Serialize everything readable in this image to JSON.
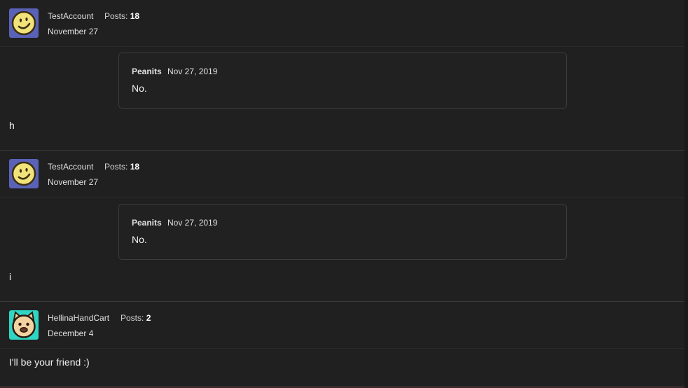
{
  "posts": [
    {
      "author": "TestAccount",
      "posts_label": "Posts:",
      "posts_count": "18",
      "date": "November 27",
      "avatar": "smiley-icon",
      "quote": {
        "author": "Peanits",
        "date": "Nov 27, 2019",
        "text": "No."
      },
      "body": "h"
    },
    {
      "author": "TestAccount",
      "posts_label": "Posts:",
      "posts_count": "18",
      "date": "November 27",
      "avatar": "smiley-icon",
      "quote": {
        "author": "Peanits",
        "date": "Nov 27, 2019",
        "text": "No."
      },
      "body": "i"
    },
    {
      "author": "HellinaHandCart",
      "posts_label": "Posts:",
      "posts_count": "2",
      "date": "December 4",
      "avatar": "cat-face-icon",
      "body": "I'll be your friend :)"
    }
  ],
  "colors": {
    "background": "#202020",
    "smiley_bg": "#5a62b8",
    "smiley_face": "#f2e27a",
    "cat_bg": "#2fd6c3",
    "cat_face": "#f4d3a2"
  }
}
